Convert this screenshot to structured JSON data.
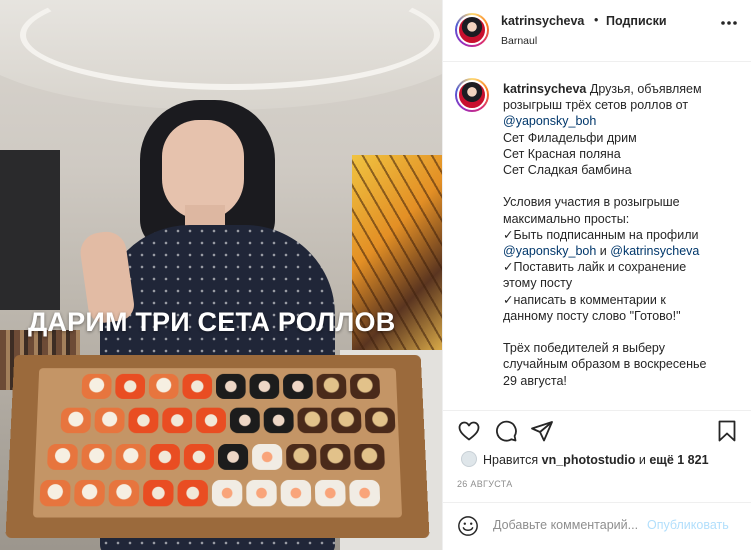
{
  "post": {
    "username": "katrinsycheva",
    "separator": "•",
    "follow_status": "Подписки",
    "location": "Barnaul"
  },
  "photo": {
    "overlay_text": "ДАРИМ ТРИ СЕТА РОЛЛОВ"
  },
  "caption": {
    "username": "katrinsycheva",
    "lines": {
      "l1": "Друзья, объявляем",
      "l2": "розыгрыш трёх сетов роллов от",
      "l3": "@yaponsky_boh",
      "l4": "Сет Филадельфи дрим",
      "l5": "Сет Красная поляна",
      "l6": "Сет Сладкая бамбина",
      "l7": "Условия участия в розыгрыше",
      "l8": "максимально просты:",
      "l9": "✓Быть подписанным на профили",
      "l10a": "@yaponsky_boh",
      "l10b": " и ",
      "l10c": "@katrinsycheva",
      "l11": "✓Поставить лайк и сохранение",
      "l12": "этому посту",
      "l13": "✓написать в комментарии к",
      "l14": "данному посту слово \"Готово!\"",
      "l15": "Трёх победителей я выберу",
      "l16": "случайным образом в воскресенье",
      "l17": "29 августа!"
    }
  },
  "likes": {
    "prefix": "Нравится ",
    "user": "vn_photostudio",
    "middle": " и ",
    "others": "ещё 1 821"
  },
  "date": "26 АВГУСТА",
  "comment": {
    "placeholder": "Добавьте комментарий...",
    "publish_label": "Опубликовать"
  },
  "icons": {
    "like": "heart-icon",
    "comment": "comment-icon",
    "share": "paper-plane-icon",
    "save": "bookmark-icon",
    "emoji": "smiley-icon",
    "more": "more-icon"
  },
  "colors": {
    "mention": "#00376b",
    "publish_disabled": "#b2dffc",
    "secondary_text": "#8e8e8e"
  }
}
